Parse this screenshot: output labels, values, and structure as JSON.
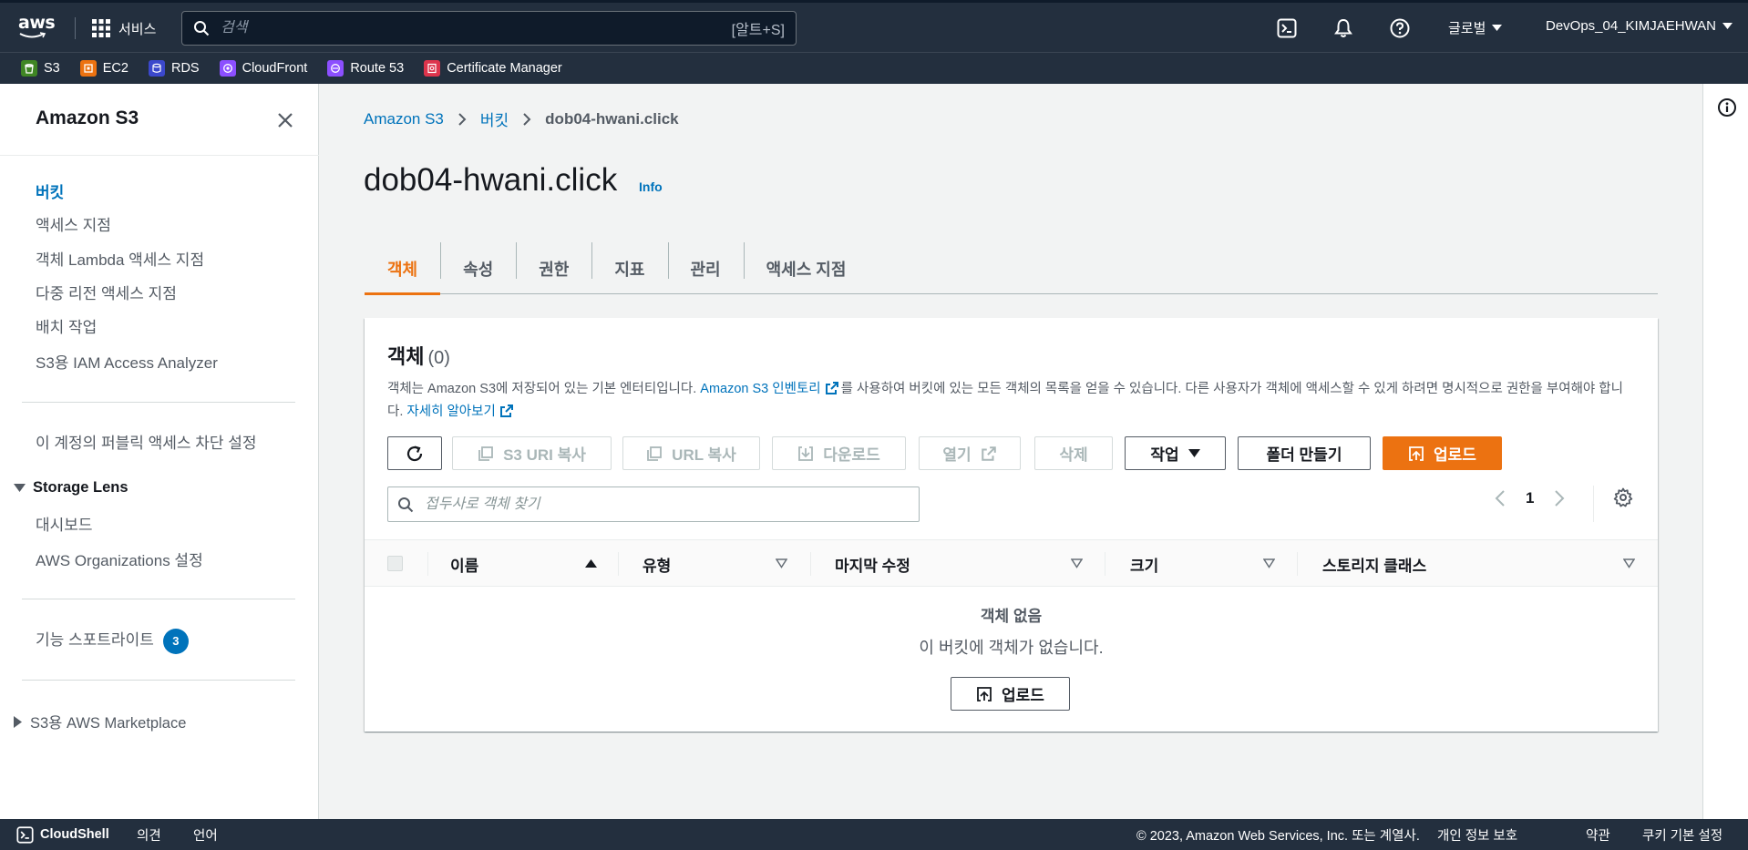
{
  "topnav": {
    "logo_text": "aws",
    "services_label": "서비스",
    "search_placeholder": "검색",
    "search_shortcut": "[알트+S]",
    "region_label": "글로벌",
    "account_label": "DevOps_04_KIMJAEHWAN"
  },
  "favorites": [
    {
      "label": "S3",
      "icon": "s3-icon",
      "color": "#3f8624"
    },
    {
      "label": "EC2",
      "icon": "ec2-icon",
      "color": "#ec7211"
    },
    {
      "label": "RDS",
      "icon": "rds-icon",
      "color": "#3b48cc"
    },
    {
      "label": "CloudFront",
      "icon": "cloudfront-icon",
      "color": "#8c4fff"
    },
    {
      "label": "Route 53",
      "icon": "route53-icon",
      "color": "#8c4fff"
    },
    {
      "label": "Certificate Manager",
      "icon": "certificate-manager-icon",
      "color": "#dd344c"
    }
  ],
  "sidebar": {
    "title": "Amazon S3",
    "items": [
      {
        "label": "버킷",
        "active": true
      },
      {
        "label": "액세스 지점"
      },
      {
        "label": "객체 Lambda 액세스 지점"
      },
      {
        "label": "다중 리전 액세스 지점"
      },
      {
        "label": "배치 작업"
      },
      {
        "label": "S3용 IAM Access Analyzer"
      }
    ],
    "block_public_access": "이 계정의 퍼블릭 액세스 차단 설정",
    "storage_lens": {
      "label": "Storage Lens",
      "items": [
        "대시보드",
        "AWS Organizations 설정"
      ]
    },
    "feature_spotlight": {
      "label": "기능 스포트라이트",
      "badge": "3"
    },
    "marketplace": "S3용 AWS Marketplace"
  },
  "breadcrumb": {
    "root": "Amazon S3",
    "middle": "버킷",
    "current": "dob04-hwani.click"
  },
  "page": {
    "title": "dob04-hwani.click",
    "info": "Info"
  },
  "tabs": [
    "객체",
    "속성",
    "권한",
    "지표",
    "관리",
    "액세스 지점"
  ],
  "objects": {
    "heading": "객체",
    "count": "(0)",
    "desc_part1": "객체는 Amazon S3에 저장되어 있는 기본 엔터티입니다. ",
    "desc_link1": "Amazon S3 인벤토리",
    "desc_part2": "를 사용하여 버킷에 있는 모든 객체의 목록을 얻을 수 있습니다. 다른 사용자가 객체에 액세스할 수 있게 하려면 명시적으로 권한을 부여해야 합니다. ",
    "desc_link2": "자세히 알아보기",
    "buttons": {
      "copy_s3_uri": "S3 URI 복사",
      "copy_url": "URL 복사",
      "download": "다운로드",
      "open": "열기",
      "delete": "삭제",
      "actions": "작업",
      "create_folder": "폴더 만들기",
      "upload": "업로드"
    },
    "filter_placeholder": "접두사로 객체 찾기",
    "page_number": "1",
    "columns": [
      "이름",
      "유형",
      "마지막 수정",
      "크기",
      "스토리지 클래스"
    ],
    "empty_title": "객체 없음",
    "empty_subtitle": "이 버킷에 객체가 없습니다.",
    "empty_upload": "업로드"
  },
  "footer": {
    "cloudshell": "CloudShell",
    "feedback": "의견",
    "language": "언어",
    "copyright": "© 2023, Amazon Web Services, Inc. 또는 계열사.",
    "privacy": "개인 정보 보호",
    "terms": "약관",
    "cookies": "쿠키 기본 설정"
  },
  "colors": {
    "nav_bg": "#232f3e",
    "accent_orange": "#ec7211",
    "link_blue": "#0073bb"
  }
}
